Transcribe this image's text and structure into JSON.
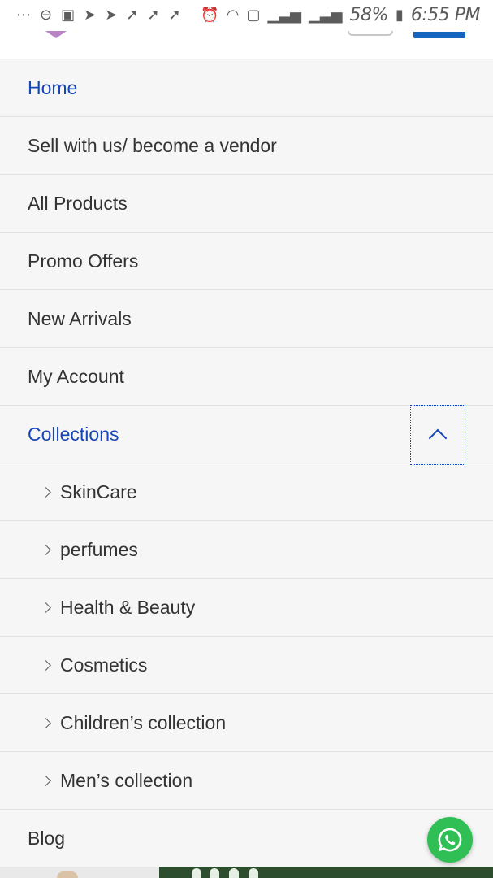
{
  "status_bar": {
    "battery": "58%",
    "time": "6:55 PM",
    "left_icons": [
      "more-icon",
      "dnd-icon",
      "image-icon",
      "telegram-icon",
      "telegram-icon",
      "pin-icon",
      "pin-icon",
      "pin-icon"
    ],
    "right_icons": [
      "alarm-icon",
      "wifi-icon",
      "sim-icon",
      "signal-icon",
      "signal-icon",
      "battery-icon"
    ]
  },
  "menu": {
    "items": [
      {
        "label": "Home",
        "active": true
      },
      {
        "label": "Sell with us/ become a vendor"
      },
      {
        "label": "All Products"
      },
      {
        "label": "Promo Offers"
      },
      {
        "label": "New Arrivals"
      },
      {
        "label": "My Account"
      },
      {
        "label": "Collections",
        "active": true,
        "expanded": true
      }
    ],
    "collections_sub": [
      {
        "label": "SkinCare"
      },
      {
        "label": "perfumes"
      },
      {
        "label": "Health & Beauty"
      },
      {
        "label": "Cosmetics"
      },
      {
        "label": "Children’s collection"
      },
      {
        "label": "Men’s collection"
      }
    ],
    "blog": {
      "label": "Blog"
    }
  },
  "fab": {
    "icon": "whatsapp-icon",
    "color": "#2fbf55"
  },
  "colors": {
    "accent": "#1646b8",
    "text": "#333333",
    "background": "#f6f6f6"
  }
}
